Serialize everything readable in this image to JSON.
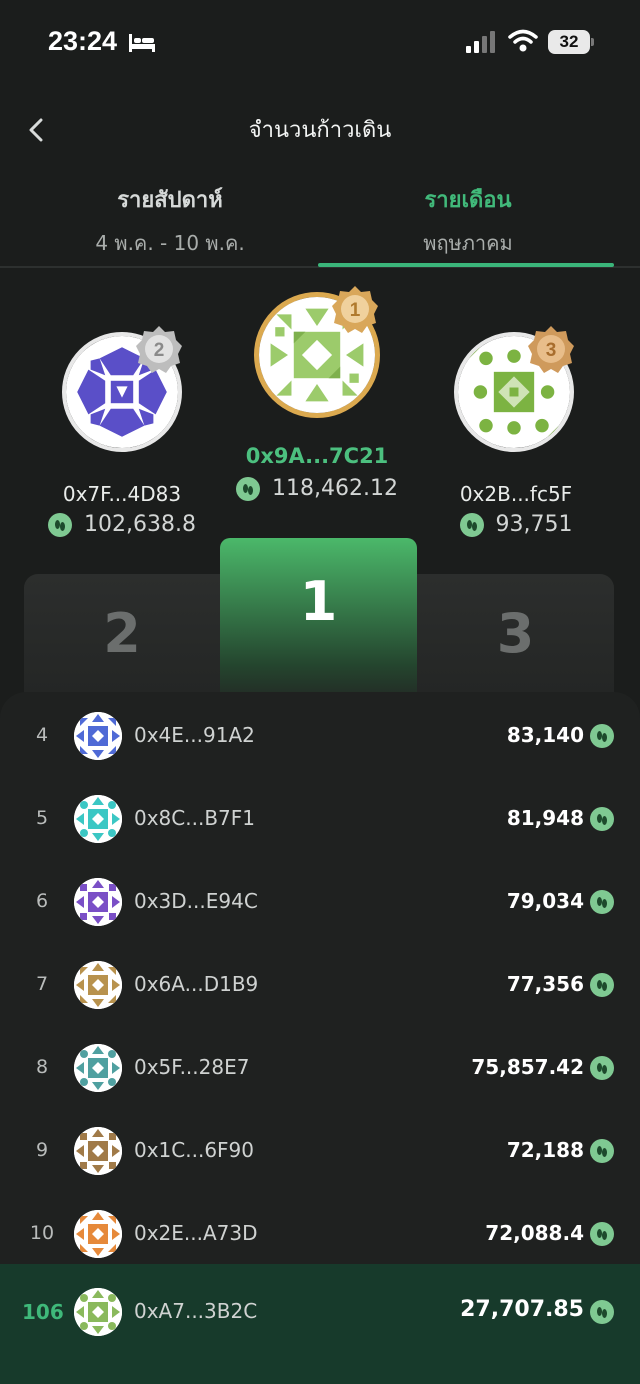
{
  "status_bar": {
    "time": "23:24",
    "battery": "32"
  },
  "header": {
    "title": "จำนวนก้าวเดิน"
  },
  "tabs": [
    {
      "label": "รายสัปดาห์",
      "sub": "4 พ.ค. - 10 พ.ค.",
      "active": false
    },
    {
      "label": "รายเดือน",
      "sub": "พฤษภาคม",
      "active": true
    }
  ],
  "podium": {
    "first": {
      "rank": "1",
      "address": "0x9A...7C21",
      "score": "118,462.12"
    },
    "second": {
      "rank": "2",
      "address": "0x7F...4D83",
      "score": "102,638.8"
    },
    "third": {
      "rank": "3",
      "address": "0x2B...fc5F",
      "score": "93,751"
    }
  },
  "leaderboard": [
    {
      "rank": "4",
      "address": "0x4E...91A2",
      "score": "83,140",
      "color": "#4f6ad6"
    },
    {
      "rank": "5",
      "address": "0x8C...B7F1",
      "score": "81,948",
      "color": "#3bc7c4"
    },
    {
      "rank": "6",
      "address": "0x3D...E94C",
      "score": "79,034",
      "color": "#7a4fc6"
    },
    {
      "rank": "7",
      "address": "0x6A...D1B9",
      "score": "77,356",
      "color": "#b8924d"
    },
    {
      "rank": "8",
      "address": "0x5F...28E7",
      "score": "75,857.42",
      "color": "#4fa0a0"
    },
    {
      "rank": "9",
      "address": "0x1C...6F90",
      "score": "72,188",
      "color": "#a07a48"
    },
    {
      "rank": "10",
      "address": "0x2E...A73D",
      "score": "72,088.4",
      "color": "#e6893a"
    }
  ],
  "my_rank": {
    "rank": "106",
    "address": "0xA7...3B2C",
    "score": "27,707.85",
    "color": "#8ab95c"
  },
  "colors": {
    "accent": "#3bb57a",
    "gold": "#dba94f",
    "silver": "#c4c4c4",
    "bronze": "#cf9b5a"
  },
  "icons": [
    "bed-icon",
    "signal-icon",
    "wifi-icon",
    "back-chevron-icon",
    "footsteps-icon",
    "medal-icon"
  ]
}
